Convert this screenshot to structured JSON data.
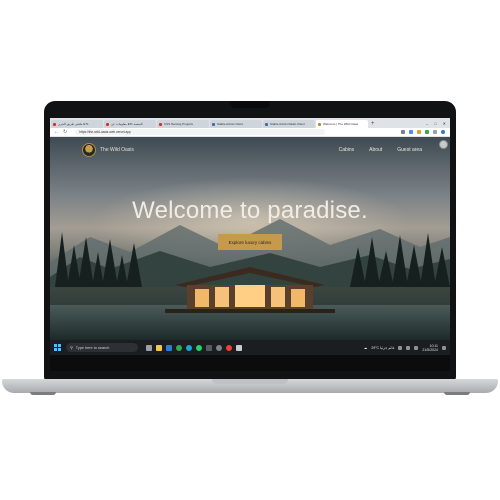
{
  "browser": {
    "tabs": [
      {
        "label": "ملتقى طريق الحرير ETL",
        "active": false,
        "favicon_color": "#d93025"
      },
      {
        "label": "معلومات عن ETL المنصة",
        "active": false,
        "favicon_color": "#d93025"
      },
      {
        "label": "CSS Naming Projects",
        "active": false,
        "favicon_color": "#d93025"
      },
      {
        "label": "Stable Admin Client",
        "active": false,
        "favicon_color": "#3a6ea5"
      },
      {
        "label": "Stable Admin Radio Client",
        "active": false,
        "favicon_color": "#3a6ea5"
      },
      {
        "label": "Welcome | The Wild Oasis",
        "active": true,
        "favicon_color": "#b68a3e"
      }
    ],
    "new_tab": "+",
    "url": "https://the-wild-oasis-web.vercel.app"
  },
  "site": {
    "logo_text": "The Wild Oasis",
    "nav": [
      "Cabins",
      "About",
      "Guest area"
    ],
    "hero_title": "Welcome to paradise.",
    "cta_label": "Explore luxury cabins",
    "accent": "#c69a4c"
  },
  "taskbar": {
    "search_placeholder": "Type here to search",
    "weather": "29°C غائم جزئيا",
    "time": "10:11",
    "date": "21/5/2024"
  }
}
